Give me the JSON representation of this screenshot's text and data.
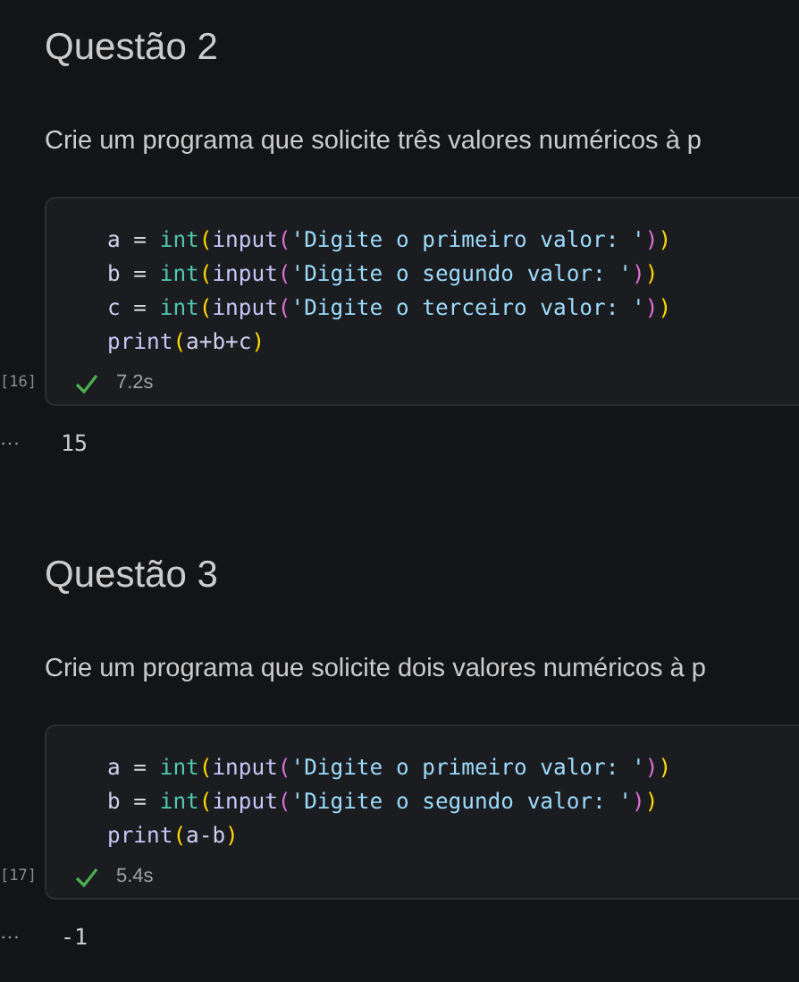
{
  "sections": [
    {
      "heading": "Questão 2",
      "description": "Crie um programa que solicite três valores numéricos à p",
      "cell": {
        "execution_count": "[16]",
        "succeeded": true,
        "duration": "7.2s",
        "code": [
          [
            {
              "kind": "name",
              "text": "a"
            },
            {
              "kind": "op",
              "text": " = "
            },
            {
              "kind": "builtin",
              "text": "int"
            },
            {
              "kind": "bracket1",
              "text": "("
            },
            {
              "kind": "func",
              "text": "input"
            },
            {
              "kind": "bracket2",
              "text": "("
            },
            {
              "kind": "string",
              "text": "'Digite o primeiro valor: '"
            },
            {
              "kind": "bracket2",
              "text": ")"
            },
            {
              "kind": "bracket1",
              "text": ")"
            }
          ],
          [
            {
              "kind": "name",
              "text": "b"
            },
            {
              "kind": "op",
              "text": " = "
            },
            {
              "kind": "builtin",
              "text": "int"
            },
            {
              "kind": "bracket1",
              "text": "("
            },
            {
              "kind": "func",
              "text": "input"
            },
            {
              "kind": "bracket2",
              "text": "("
            },
            {
              "kind": "string",
              "text": "'Digite o segundo valor: '"
            },
            {
              "kind": "bracket2",
              "text": ")"
            },
            {
              "kind": "bracket1",
              "text": ")"
            }
          ],
          [
            {
              "kind": "name",
              "text": "c"
            },
            {
              "kind": "op",
              "text": " = "
            },
            {
              "kind": "builtin",
              "text": "int"
            },
            {
              "kind": "bracket1",
              "text": "("
            },
            {
              "kind": "func",
              "text": "input"
            },
            {
              "kind": "bracket2",
              "text": "("
            },
            {
              "kind": "string",
              "text": "'Digite o terceiro valor: '"
            },
            {
              "kind": "bracket2",
              "text": ")"
            },
            {
              "kind": "bracket1",
              "text": ")"
            }
          ],
          [
            {
              "kind": "func",
              "text": "print"
            },
            {
              "kind": "bracket1",
              "text": "("
            },
            {
              "kind": "name",
              "text": "a+b+c"
            },
            {
              "kind": "bracket1",
              "text": ")"
            }
          ]
        ],
        "output_marker": "···",
        "output": "15"
      }
    },
    {
      "heading": "Questão 3",
      "description": "Crie um programa que solicite dois valores numéricos à p",
      "cell": {
        "execution_count": "[17]",
        "succeeded": true,
        "duration": "5.4s",
        "code": [
          [
            {
              "kind": "name",
              "text": "a"
            },
            {
              "kind": "op",
              "text": " = "
            },
            {
              "kind": "builtin",
              "text": "int"
            },
            {
              "kind": "bracket1",
              "text": "("
            },
            {
              "kind": "func",
              "text": "input"
            },
            {
              "kind": "bracket2",
              "text": "("
            },
            {
              "kind": "string",
              "text": "'Digite o primeiro valor: '"
            },
            {
              "kind": "bracket2",
              "text": ")"
            },
            {
              "kind": "bracket1",
              "text": ")"
            }
          ],
          [
            {
              "kind": "name",
              "text": "b"
            },
            {
              "kind": "op",
              "text": " = "
            },
            {
              "kind": "builtin",
              "text": "int"
            },
            {
              "kind": "bracket1",
              "text": "("
            },
            {
              "kind": "func",
              "text": "input"
            },
            {
              "kind": "bracket2",
              "text": "("
            },
            {
              "kind": "string",
              "text": "'Digite o segundo valor: '"
            },
            {
              "kind": "bracket2",
              "text": ")"
            },
            {
              "kind": "bracket1",
              "text": ")"
            }
          ],
          [
            {
              "kind": "func",
              "text": "print"
            },
            {
              "kind": "bracket1",
              "text": "("
            },
            {
              "kind": "name",
              "text": "a-b"
            },
            {
              "kind": "bracket1",
              "text": ")"
            }
          ]
        ],
        "output_marker": "···",
        "output": "-1"
      }
    }
  ]
}
